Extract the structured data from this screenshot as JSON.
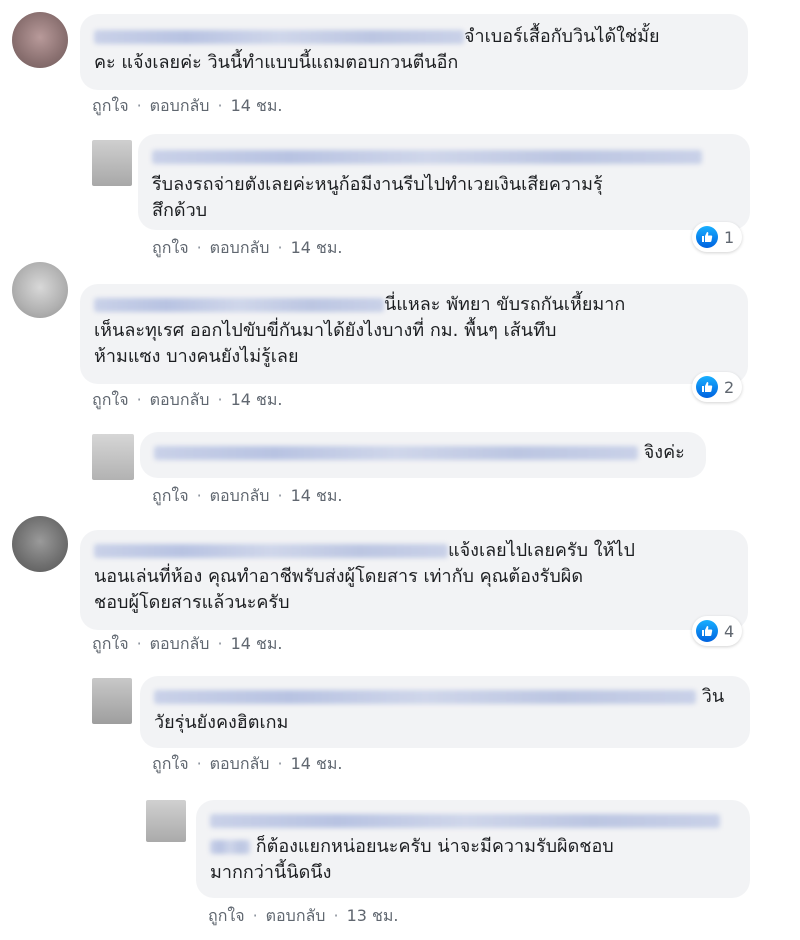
{
  "comments": [
    {
      "text": "จำเบอร์เสื้อกับวินได้ใช่มั้ยคะ แจ้งเลยค่ะ วินนี้ทำแบบนี้แถมตอบกวนตีนอีก",
      "line1": "จำเบอร์เสื้อกับวินได้ใช่มั้ย",
      "line2": "คะ แจ้งเลยค่ะ วินนี้ทำแบบนี้แถมตอบกวนตีนอีก",
      "like": "ถูกใจ",
      "reply": "ตอบกลับ",
      "time": "14 ชม."
    },
    {
      "line1": "รีบลงรถจ่ายตังเลยค่ะหนูก้อมีงานรีบไปทำเวยเงินเสียความรุ้",
      "line2": "สึกด้วบ",
      "like": "ถูกใจ",
      "reply": "ตอบกลับ",
      "time": "14 ชม.",
      "reactions": "1"
    },
    {
      "line1": "นี่แหละ พัทยา ขับรถกันเหี้ยมาก",
      "line2": "เห็นละทุเรศ ออกไปขับขี่กันมาได้ยังไงบางที่ กม. พื้นๆ เส้นทึบ",
      "line3": "ห้ามแซง บางคนยังไม่รู้เลย",
      "like": "ถูกใจ",
      "reply": "ตอบกลับ",
      "time": "14 ชม.",
      "reactions": "2"
    },
    {
      "line1": "จิงค่ะ",
      "like": "ถูกใจ",
      "reply": "ตอบกลับ",
      "time": "14 ชม."
    },
    {
      "line1": "แจ้งเลยไปเลยครับ ให้ไป",
      "line2": "นอนเล่นที่ห้อง คุณทำอาชีพรับส่งผู้โดยสาร เท่ากับ คุณต้องรับผิด",
      "line3": "ชอบผู้โดยสารแล้วนะครับ",
      "like": "ถูกใจ",
      "reply": "ตอบกลับ",
      "time": "14 ชม.",
      "reactions": "4"
    },
    {
      "line1": "วิน",
      "line2": "วัยรุ่นยังคงฮิตเกม",
      "like": "ถูกใจ",
      "reply": "ตอบกลับ",
      "time": "14 ชม."
    },
    {
      "line1": "ก็ต้องแยกหน่อยนะครับ น่าจะมีความรับผิดชอบ",
      "line2": "มากกว่านี้นิดนึง",
      "like": "ถูกใจ",
      "reply": "ตอบกลับ",
      "time": "13 ชม."
    }
  ],
  "separator": "·",
  "colors": {
    "bubble": "#f2f3f5",
    "meta": "#606770",
    "like_blue": "#1877f2"
  },
  "icons": {
    "reaction": "like-icon"
  }
}
